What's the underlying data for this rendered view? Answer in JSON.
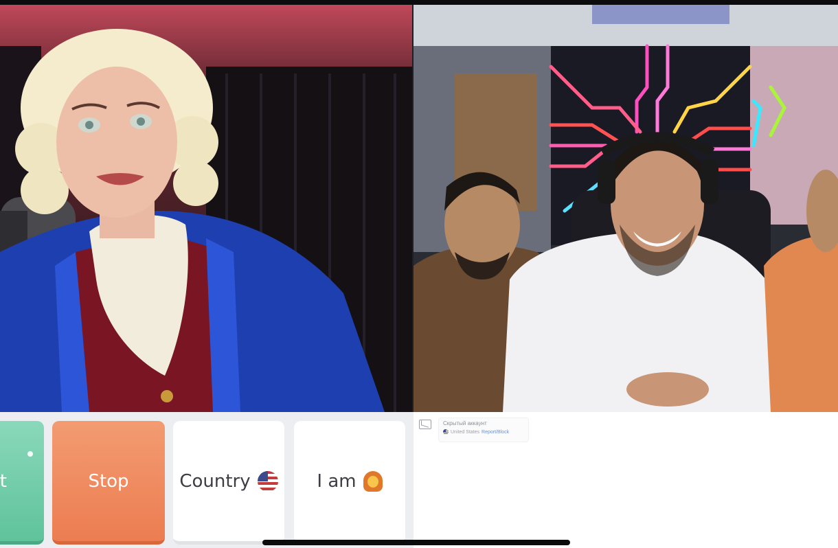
{
  "controls": {
    "start_label": "t",
    "stop_label": "Stop",
    "country_label": "Country",
    "country_flag_icon": "us-flag-icon",
    "iam_label": "I am",
    "iam_icon": "woman-emoji-icon"
  },
  "partner": {
    "name": "Скрытый аккаунт",
    "location": "United States",
    "location_link": "Report/Block"
  },
  "colors": {
    "start": "#6ccba6",
    "stop": "#ef8a5e",
    "neutral": "#ffffff"
  }
}
